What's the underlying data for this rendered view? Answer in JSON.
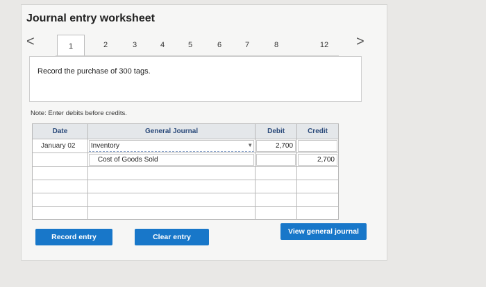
{
  "title": "Journal entry worksheet",
  "tabs": [
    "1",
    "2",
    "3",
    "4",
    "5",
    "6",
    "7",
    "8",
    "12"
  ],
  "active_tab": "1",
  "nav": {
    "prev": "<",
    "next": ">"
  },
  "prompt": "Record the purchase of 300 tags.",
  "note": "Note: Enter debits before credits.",
  "table": {
    "headers": {
      "date": "Date",
      "account": "General Journal",
      "debit": "Debit",
      "credit": "Credit"
    },
    "rows": [
      {
        "date": "January 02",
        "account": "Inventory",
        "debit": "2,700",
        "credit": ""
      },
      {
        "date": "",
        "account": "Cost of Goods Sold",
        "debit": "",
        "credit": "2,700"
      },
      {
        "date": "",
        "account": "",
        "debit": "",
        "credit": ""
      },
      {
        "date": "",
        "account": "",
        "debit": "",
        "credit": ""
      },
      {
        "date": "",
        "account": "",
        "debit": "",
        "credit": ""
      },
      {
        "date": "",
        "account": "",
        "debit": "",
        "credit": ""
      }
    ]
  },
  "buttons": {
    "record": "Record entry",
    "clear": "Clear entry",
    "view": "View general journal"
  },
  "colors": {
    "button": "#1877c9",
    "header_text": "#2b4a7a"
  }
}
